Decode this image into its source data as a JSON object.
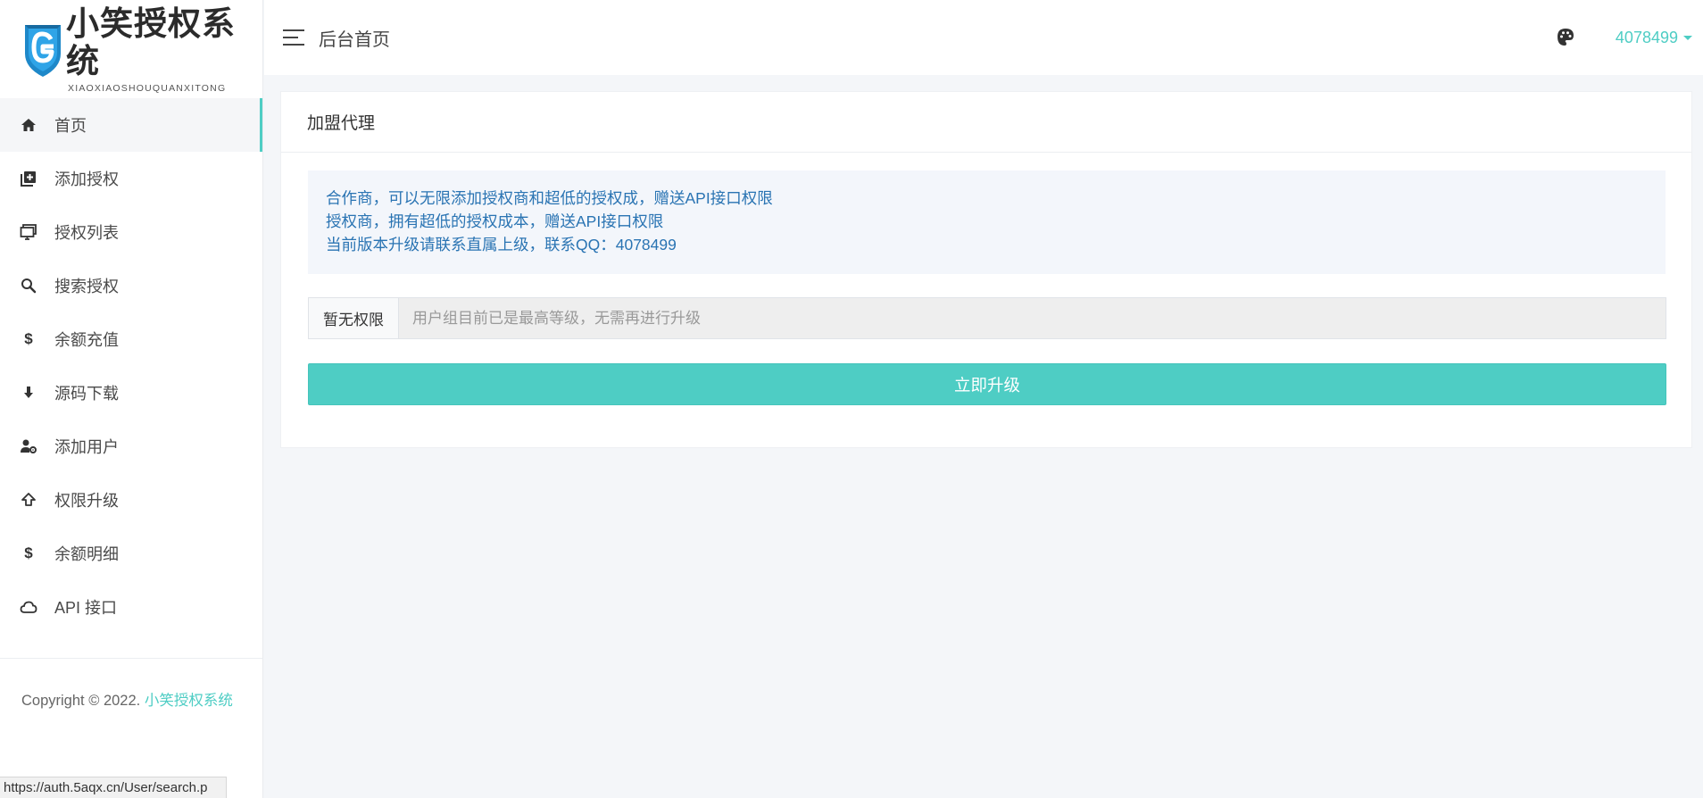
{
  "logo": {
    "title": "小笑授权系统",
    "subtitle": "XIAOXIAOSHOUQUANXITONG",
    "shield_color": "#1e88c9",
    "icon": "shield-g-icon"
  },
  "sidebar": {
    "items": [
      {
        "label": "首页",
        "icon": "home-icon",
        "active": true
      },
      {
        "label": "添加授权",
        "icon": "add-box-icon"
      },
      {
        "label": "授权列表",
        "icon": "monitor-icon"
      },
      {
        "label": "搜索授权",
        "icon": "search-icon"
      },
      {
        "label": "余额充值",
        "icon": "dollar-icon"
      },
      {
        "label": "源码下载",
        "icon": "download-arrow-icon"
      },
      {
        "label": "添加用户",
        "icon": "user-cog-icon"
      },
      {
        "label": "权限升级",
        "icon": "upgrade-arrow-icon"
      },
      {
        "label": "余额明细",
        "icon": "dollar-icon"
      },
      {
        "label": "API 接口",
        "icon": "cloud-icon"
      }
    ],
    "copyright_prefix": "Copyright © 2022. ",
    "copyright_brand": "小笑授权系统"
  },
  "status_bar": {
    "url": "https://auth.5aqx.cn/User/search.p"
  },
  "header": {
    "menu_icon": "hamburger-icon",
    "title": "后台首页",
    "theme_icon": "palette-icon",
    "username": "4078499"
  },
  "card": {
    "title": "加盟代理",
    "notice_lines": [
      "合作商，可以无限添加授权商和超低的授权成，赠送API接口权限",
      "授权商，拥有超低的授权成本，赠送API接口权限",
      "当前版本升级请联系直属上级，联系QQ：4078499"
    ],
    "addon_label": "暂无权限",
    "input_placeholder": "用户组目前已是最高等级，无需再进行升级",
    "button_label": "立即升级"
  },
  "colors": {
    "accent": "#4ecdc4",
    "notice_text": "#2a74b3",
    "notice_bg": "#f3f6fb",
    "page_bg": "#f4f6f9"
  }
}
